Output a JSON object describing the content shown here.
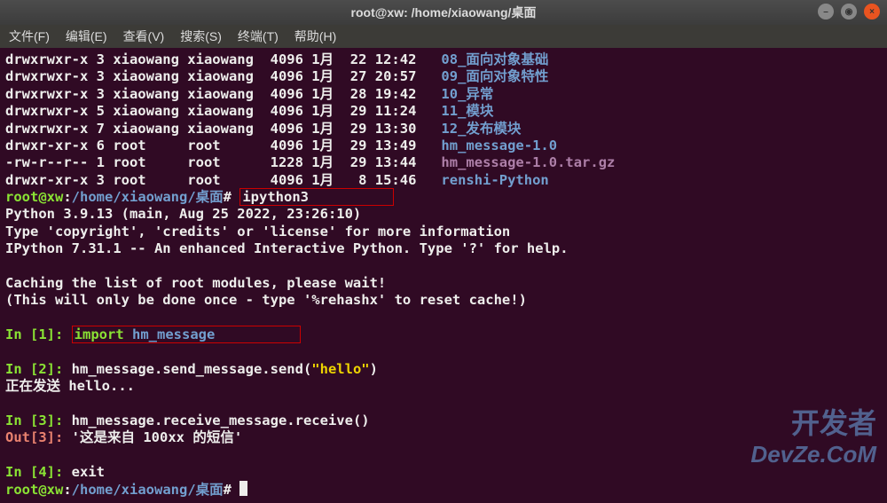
{
  "window": {
    "title": "root@xw: /home/xiaowang/桌面"
  },
  "menu": {
    "file": "文件(F)",
    "edit": "编辑(E)",
    "view": "查看(V)",
    "search": "搜索(S)",
    "terminal": "终端(T)",
    "help": "帮助(H)"
  },
  "ls": [
    {
      "perm": "drwxrwxr-x",
      "links": "3",
      "owner": "xiaowang",
      "group": "xiaowang",
      "size": "4096",
      "month": "1月",
      "day": "22",
      "time": "12:42",
      "name": "08_面向对象基础",
      "type": "dir"
    },
    {
      "perm": "drwxrwxr-x",
      "links": "3",
      "owner": "xiaowang",
      "group": "xiaowang",
      "size": "4096",
      "month": "1月",
      "day": "27",
      "time": "20:57",
      "name": "09_面向对象特性",
      "type": "dir"
    },
    {
      "perm": "drwxrwxr-x",
      "links": "3",
      "owner": "xiaowang",
      "group": "xiaowang",
      "size": "4096",
      "month": "1月",
      "day": "28",
      "time": "19:42",
      "name": "10_异常",
      "type": "dir"
    },
    {
      "perm": "drwxrwxr-x",
      "links": "5",
      "owner": "xiaowang",
      "group": "xiaowang",
      "size": "4096",
      "month": "1月",
      "day": "29",
      "time": "11:24",
      "name": "11_模块",
      "type": "dir"
    },
    {
      "perm": "drwxrwxr-x",
      "links": "7",
      "owner": "xiaowang",
      "group": "xiaowang",
      "size": "4096",
      "month": "1月",
      "day": "29",
      "time": "13:30",
      "name": "12_发布模块",
      "type": "dir"
    },
    {
      "perm": "drwxr-xr-x",
      "links": "6",
      "owner": "root",
      "group": "root",
      "size": "4096",
      "month": "1月",
      "day": "29",
      "time": "13:49",
      "name": "hm_message-1.0",
      "type": "dir"
    },
    {
      "perm": "-rw-r--r--",
      "links": "1",
      "owner": "root",
      "group": "root",
      "size": "1228",
      "month": "1月",
      "day": "29",
      "time": "13:44",
      "name": "hm_message-1.0.tar.gz",
      "type": "file"
    },
    {
      "perm": "drwxr-xr-x",
      "links": "3",
      "owner": "root",
      "group": "root",
      "size": "4096",
      "month": "1月",
      "day": "8",
      "time": "15:46",
      "name": "renshi-Python",
      "type": "dir"
    }
  ],
  "prompt": {
    "user": "root@xw",
    "sep": ":",
    "path": "/home/xiaowang/桌面",
    "hash": "#"
  },
  "cmd1": "ipython3",
  "banner": {
    "l1": "Python 3.9.13 (main, Aug 25 2022, 23:26:10) ",
    "l2": "Type 'copyright', 'credits' or 'license' for more information",
    "l3": "IPython 7.31.1 -- An enhanced Interactive Python. Type '?' for help."
  },
  "cache": {
    "l1": "Caching the list of root modules, please wait!",
    "l2": "(This will only be done once - type '%rehashx' to reset cache!)"
  },
  "ipy": {
    "in1_kw": "import",
    "in1_mod": "hm_message",
    "in2": "hm_message.send_message.send(",
    "in2_str": "\"hello\"",
    "in2_end": ")",
    "out2_print": "正在发送 hello...",
    "in3": "hm_message.receive_message.receive()",
    "out3": "'这是来自 100xx 的短信'",
    "in4": "exit"
  },
  "labels": {
    "in": "In [",
    "out": "Out[",
    "close": "]: "
  },
  "watermark": {
    "l1": "开发者",
    "l2": "DevZe.CoM"
  }
}
